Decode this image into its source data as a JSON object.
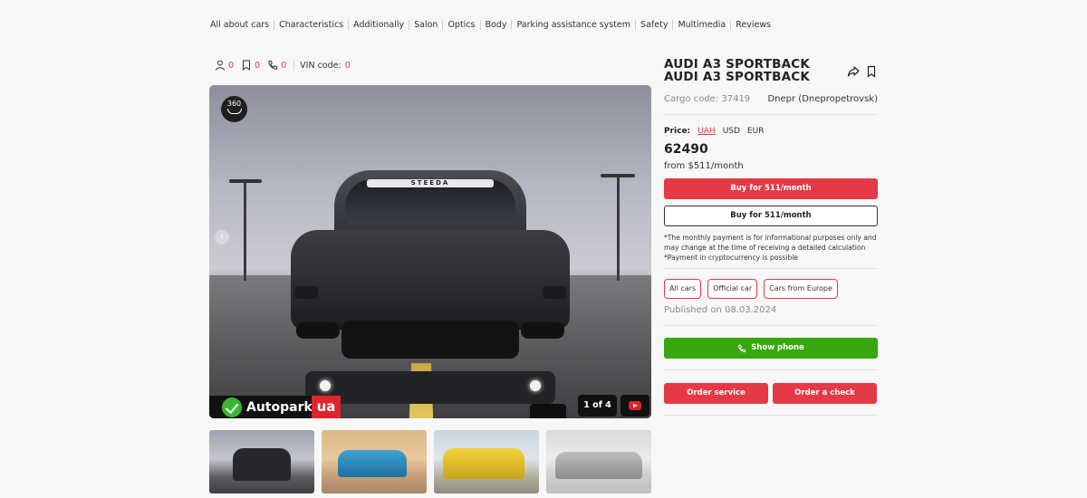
{
  "nav": {
    "items": [
      "All about cars",
      "Characteristics",
      "Additionally",
      "Salon",
      "Optics",
      "Body",
      "Parking assistance system",
      "Safety",
      "Multimedia",
      "Reviews"
    ]
  },
  "stats": {
    "views": "0",
    "saved": "0",
    "calls": "0",
    "vin_label": "VIN code:",
    "vin_value": "0"
  },
  "gallery": {
    "badge_360": "360",
    "windshield_text": "STEEDA",
    "brand_name": "Autopark",
    "brand_suffix": "ua",
    "counter": "1 of 4",
    "arrow_left": "‹",
    "arrow_right": "›"
  },
  "listing": {
    "title": "AUDI A3 SPORTBACK AUDI A3 SPORTBACK",
    "cargo_code": "Cargo code: 37419",
    "city": "Dnepr (Dnepropetrovsk)",
    "price_label": "Price:",
    "currencies": [
      "UAH",
      "USD",
      "EUR"
    ],
    "active_currency": "UAH",
    "price": "62490",
    "monthly": "from $511/month",
    "buy_button_primary": "Buy for 511/month",
    "buy_button_secondary": "Buy for 511/month",
    "note_line1": "*The monthly payment is for informational purposes only and may change at the time of receiving a detailed calculation",
    "note_line2": "*Payment in cryptocurrency is possible",
    "tags": [
      "All cars",
      "Official car",
      "Cars from Europe"
    ],
    "published": "Published on 08.03.2024",
    "show_phone": "Show phone",
    "order_service": "Order service",
    "order_check": "Order a check"
  },
  "colors": {
    "accent_red": "#e53946",
    "green": "#36a70f",
    "brand_green": "#38b832",
    "brand_red": "#e0242b"
  }
}
